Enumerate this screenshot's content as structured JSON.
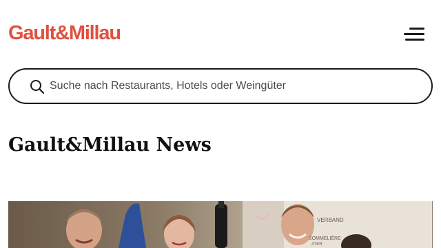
{
  "header": {
    "logo_text": "Gault&Millau",
    "brand_color": "#e2503f",
    "menu_icon": "hamburger-menu-icon"
  },
  "search": {
    "placeholder": "Suche nach Restaurants, Hotels oder Weingüter",
    "value": "",
    "icon": "search-icon"
  },
  "main": {
    "title": "Gault&Millau News"
  },
  "hero": {
    "banner_text_1": "VERBAND",
    "banner_text_2": "SOMMELIÈRE",
    "banner_text_3": "ATER"
  }
}
